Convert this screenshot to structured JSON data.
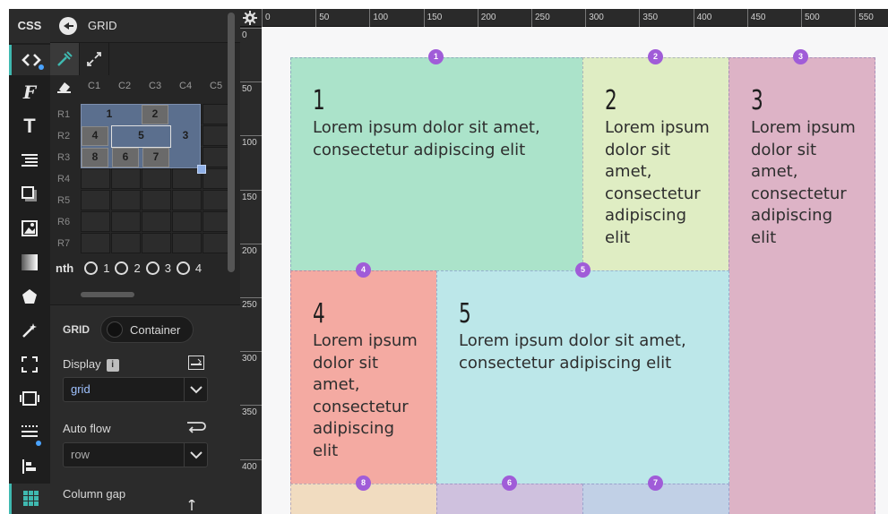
{
  "rail": {
    "header": "CSS",
    "items": [
      {
        "name": "code-icon"
      },
      {
        "name": "font-family-icon"
      },
      {
        "name": "text-icon"
      },
      {
        "name": "list-icon"
      },
      {
        "name": "box-shadow-icon"
      },
      {
        "name": "image-icon"
      },
      {
        "name": "gradient-icon"
      },
      {
        "name": "shape-icon"
      },
      {
        "name": "magic-wand-icon"
      },
      {
        "name": "fullscreen-icon"
      },
      {
        "name": "layers-icon"
      },
      {
        "name": "lines-icon"
      },
      {
        "name": "align-icon"
      },
      {
        "name": "grid-icon"
      }
    ]
  },
  "panel": {
    "title": "GRID",
    "columns": [
      "C1",
      "C2",
      "C3",
      "C4",
      "C5"
    ],
    "rows": [
      "R1",
      "R2",
      "R3",
      "R4",
      "R5",
      "R6",
      "R7"
    ],
    "grid_items": [
      "1",
      "2",
      "4",
      "5",
      "3",
      "8",
      "6",
      "7"
    ],
    "nth_label": "nth",
    "nth_options": [
      "1",
      "2",
      "3",
      "4"
    ],
    "grid_label": "GRID",
    "container_toggle": "Container",
    "display_label": "Display",
    "display_info": "i",
    "display_value": "grid",
    "auto_flow_label": "Auto flow",
    "auto_flow_value": "row",
    "column_gap_label": "Column gap"
  },
  "ruler": {
    "top": [
      "0",
      "50",
      "100",
      "150",
      "200",
      "250",
      "300",
      "350",
      "400",
      "450",
      "500",
      "550"
    ],
    "left": [
      "0",
      "50",
      "100",
      "150",
      "200",
      "250",
      "300",
      "350",
      "400"
    ]
  },
  "canvas": {
    "items": [
      {
        "num": "1",
        "text": "Lorem ipsum dolor sit amet, consectetur adipiscing elit",
        "color": "#abe3ca"
      },
      {
        "num": "2",
        "text": "Lorem ipsum dolor sit amet, consectetur adipiscing elit",
        "color": "#dfedc3"
      },
      {
        "num": "3",
        "text": "Lorem ipsum dolor sit amet, consectetur adipiscing elit",
        "color": "#ddb3c6"
      },
      {
        "num": "4",
        "text": "Lorem ipsum dolor sit amet, consectetur adipiscing elit",
        "color": "#f4aaa2"
      },
      {
        "num": "5",
        "text": "Lorem ipsum dolor sit amet, consectetur adipiscing elit",
        "color": "#bce7e9"
      }
    ],
    "markers": [
      "1",
      "2",
      "3",
      "4",
      "5",
      "8",
      "6",
      "7"
    ],
    "bottom_colors": [
      "#f1dcc0",
      "#cfc1de",
      "#c1d0e6"
    ]
  }
}
